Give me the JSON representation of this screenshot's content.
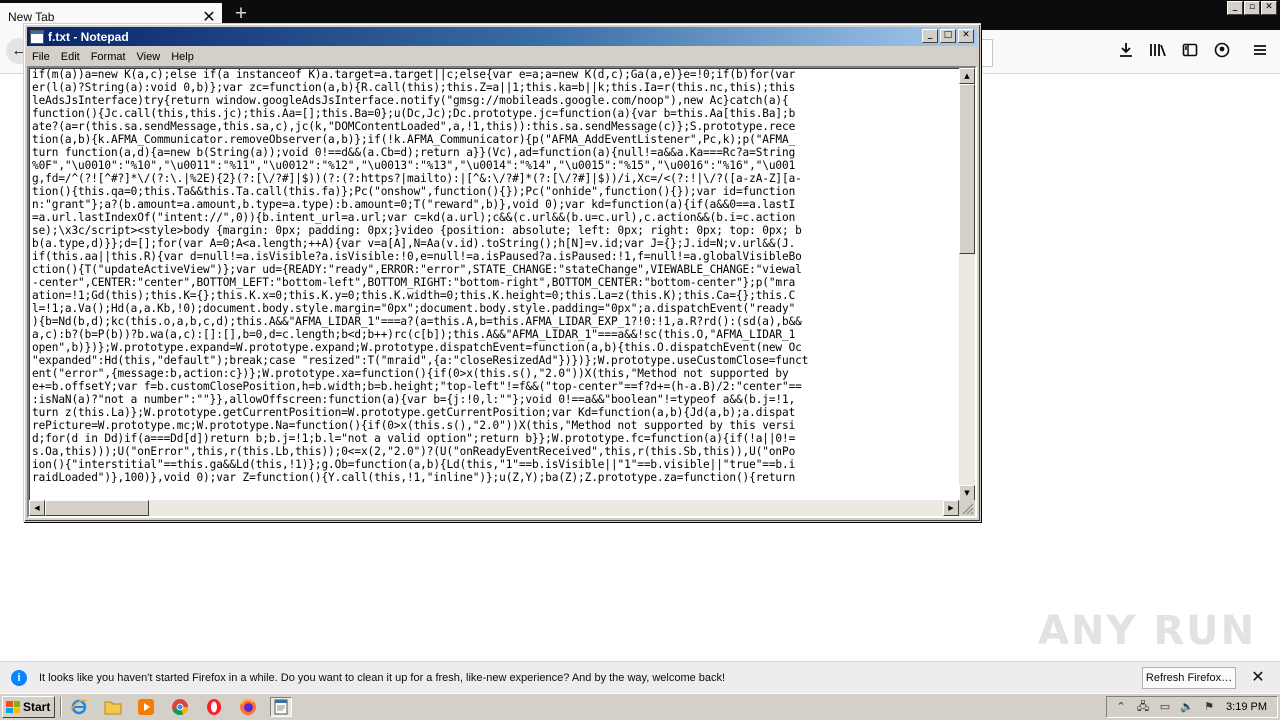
{
  "firefox": {
    "tab_title": "New Tab",
    "tab_close": "✕",
    "new_tab": "+",
    "back": "←",
    "toolbar_icons": [
      "download-icon",
      "library-icon",
      "sidebar-icon",
      "account-icon",
      "menu-icon"
    ],
    "notification": {
      "icon": "i",
      "text": "It looks like you haven't started Firefox in a while. Do you want to clean it up for a fresh, like-new experience? And by the way, welcome back!",
      "button": "Refresh Firefox…",
      "close": "✕"
    }
  },
  "notepad": {
    "title": "f.txt - Notepad",
    "menu": [
      "File",
      "Edit",
      "Format",
      "View",
      "Help"
    ],
    "lines": [
      "if(m(a))a=new K(a,c);else if(a instanceof K)a.target=a.target||c;else{var e=a;a=new K(d,c);Ga(a,e)}e=!0;if(b)for(var",
      "er(l(a)?String(a):void 0,b)};var zc=function(a,b){R.call(this);this.Z=a||1;this.ka=b||k;this.Ia=r(this.nc,this);this",
      "leAdsJsInterface)try{return window.googleAdsJsInterface.notify(\"gmsg://mobileads.google.com/noop\"),new Ac}catch(a){",
      "function(){Jc.call(this,this.jc);this.Aa=[];this.Ba=0};u(Dc,Jc);Dc.prototype.jc=function(a){var b=this.Aa[this.Ba];b",
      "ate?(a=r(this.sa.sendMessage,this.sa,c),jc(k,\"DOMContentLoaded\",a,!1,this)):this.sa.sendMessage(c)};S.prototype.rece",
      "tion(a,b){k.AFMA_Communicator.removeObserver(a,b)};if(!k.AFMA_Communicator){p(\"AFMA_AddEventListener\",Pc,k);p(\"AFMA_",
      "turn function(a,d){a=new b(String(a));void 0!==d&&(a.Cb=d);return a}}(Vc),ad=function(a){null!=a&&a.Ka===Rc?a=String",
      "%0F\",\"\\u0010\":\"%10\",\"\\u0011\":\"%11\",\"\\u0012\":\"%12\",\"\\u0013\":\"%13\",\"\\u0014\":\"%14\",\"\\u0015\":\"%15\",\"\\u0016\":\"%16\",\"\\u001",
      "g,fd=/^(?![^#?]*\\/(?:\\.|%2E){2}(?:[\\/?#]|$))(?:(?:https?|mailto):|[^&:\\/?#]*(?:[\\/?#]|$))/i,Xc=/<(?:!|\\/?([a-zA-Z][a-",
      "tion(){this.qa=0;this.Ta&&this.Ta.call(this.fa)};Pc(\"onshow\",function(){});Pc(\"onhide\",function(){});var id=function",
      "n:\"grant\"};a?(b.amount=a.amount,b.type=a.type):b.amount=0;T(\"reward\",b)},void 0);var kd=function(a){if(a&&0==a.lastI",
      "=a.url.lastIndexOf(\"intent://\",0)){b.intent_url=a.url;var c=kd(a.url);c&&(c.url&&(b.u=c.url),c.action&&(b.i=c.action",
      "se);\\x3c/script><style>body {margin: 0px; padding: 0px;}video {position: absolute; left: 0px; right: 0px; top: 0px; b",
      "b(a.type,d)}};d=[];for(var A=0;A<a.length;++A){var v=a[A],N=Aa(v.id).toString();h[N]=v.id;var J={};J.id=N;v.url&&(J.",
      "if(this.aa||this.R){var d=null!=a.isVisible?a.isVisible:!0,e=null!=a.isPaused?a.isPaused:!1,f=null!=a.globalVisibleBo",
      "ction(){T(\"updateActiveView\")};var ud={READY:\"ready\",ERROR:\"error\",STATE_CHANGE:\"stateChange\",VIEWABLE_CHANGE:\"viewal",
      "-center\",CENTER:\"center\",BOTTOM_LEFT:\"bottom-left\",BOTTOM_RIGHT:\"bottom-right\",BOTTOM_CENTER:\"bottom-center\"};p(\"mra",
      "ation=!1;Gd(this);this.K={};this.K.x=0;this.K.y=0;this.K.width=0;this.K.height=0;this.La=z(this.K);this.Ca={};this.C",
      "l=!1;a.Va();Hd(a,a.Kb,!0);document.body.style.margin=\"0px\";document.body.style.padding=\"0px\";a.dispatchEvent(\"ready\"",
      "){b=Nd(b,d);kc(this.o,a,b,c,d);this.A&&\"AFMA_LIDAR_1\"===a?(a=this.A,b=this.AFMA_LIDAR_EXP_1?!0:!1,a.R?rd():(sd(a),b&&",
      "a,c):b?(b=P(b))?b.wa(a,c):[]:[],b=0,d=c.length;b<d;b++)rc(c[b]);this.A&&\"AFMA_LIDAR_1\"===a&&!sc(this.O,\"AFMA_LIDAR_1",
      "open\",b)})};W.prototype.expand=W.prototype.expand;W.prototype.dispatchEvent=function(a,b){this.O.dispatchEvent(new Oc",
      "\"expanded\":Hd(this,\"default\");break;case \"resized\":T(\"mraid\",{a:\"closeResizedAd\"})})};W.prototype.useCustomClose=funct",
      "ent(\"error\",{message:b,action:c})};W.prototype.xa=function(){if(0>x(this.s(),\"2.0\"))X(this,\"Method not supported by",
      "e+=b.offsetY;var f=b.customClosePosition,h=b.width;b=b.height;\"top-left\"!=f&&(\"top-center\"==f?d+=(h-a.B)/2:\"center\"==",
      ":isNaN(a)?\"not a number\":\"\"}},allowOffscreen:function(a){var b={j:!0,l:\"\"};void 0!==a&&\"boolean\"!=typeof a&&(b.j=!1,",
      "turn z(this.La)};W.prototype.getCurrentPosition=W.prototype.getCurrentPosition;var Kd=function(a,b){Jd(a,b);a.dispat",
      "rePicture=W.prototype.mc;W.prototype.Na=function(){if(0>x(this.s(),\"2.0\"))X(this,\"Method not supported by this versi",
      "d;for(d in Dd)if(a===Dd[d])return b;b.j=!1;b.l=\"not a valid option\";return b}};W.prototype.fc=function(a){if(!a||0!=",
      "s.Oa,this)));U(\"onError\",this,r(this.Lb,this));0<=x(2,\"2.0\")?(U(\"onReadyEventReceived\",this,r(this.Sb,this)),U(\"onPo",
      "ion(){\"interstitial\"==this.ga&&Ld(this,!1)};g.Ob=function(a,b){Ld(this,\"1\"==b.isVisible||\"1\"==b.visible||\"true\"==b.i",
      "raidLoaded\")},100)},void 0);var Z=function(){Y.call(this,!1,\"inline\")};u(Z,Y);ba(Z);Z.prototype.za=function(){return"
    ]
  },
  "taskbar": {
    "start": "Start",
    "apps": [
      "ie-icon",
      "explorer-icon",
      "media-player-icon",
      "chrome-icon",
      "opera-icon",
      "firefox-icon",
      "notepad-icon"
    ],
    "clock": "3:19 PM"
  },
  "watermark": "ANY RUN",
  "colors": {
    "titlebar_start": "#0a246a",
    "titlebar_end": "#a6caf0",
    "notif_accent": "#0a84ff",
    "firefox_orange": "#ff7139"
  }
}
